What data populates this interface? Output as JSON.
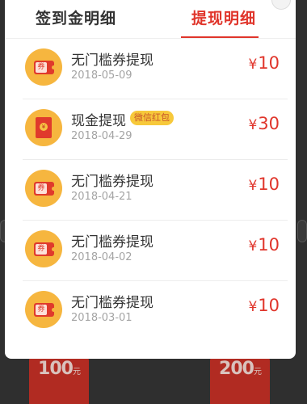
{
  "tabs": [
    {
      "label": "签到金明细",
      "active": false
    },
    {
      "label": "提现明细",
      "active": true
    }
  ],
  "records": [
    {
      "title": "无门槛券提现",
      "date": "2018-05-09",
      "currency": "¥",
      "amount": "10",
      "badge": "",
      "icon": "coupon-icon",
      "icon_text": "券"
    },
    {
      "title": "现金提现",
      "date": "2018-04-29",
      "currency": "¥",
      "amount": "30",
      "badge": "微信红包",
      "icon": "red-envelope-icon",
      "icon_text": "¥"
    },
    {
      "title": "无门槛券提现",
      "date": "2018-04-21",
      "currency": "¥",
      "amount": "10",
      "badge": "",
      "icon": "coupon-icon",
      "icon_text": "券"
    },
    {
      "title": "无门槛券提现",
      "date": "2018-04-02",
      "currency": "¥",
      "amount": "10",
      "badge": "",
      "icon": "coupon-icon",
      "icon_text": "券"
    },
    {
      "title": "无门槛券提现",
      "date": "2018-03-01",
      "currency": "¥",
      "amount": "10",
      "badge": "",
      "icon": "coupon-icon",
      "icon_text": "券"
    }
  ],
  "background": {
    "cards": [
      {
        "value": "100",
        "unit": "元"
      },
      {
        "value": "200",
        "unit": "元"
      }
    ]
  },
  "colors": {
    "accent": "#e0352b",
    "icon_bg": "#f6b63f",
    "badge_bg": "#f7c93b"
  }
}
